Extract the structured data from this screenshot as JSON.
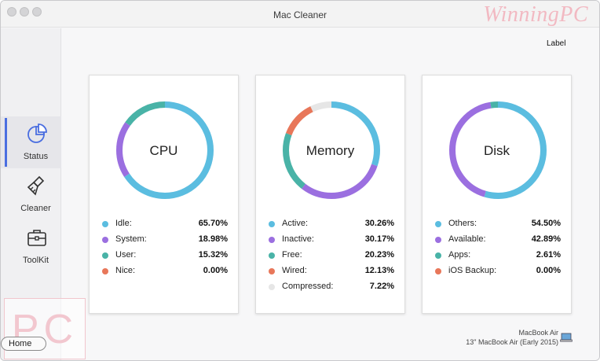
{
  "window": {
    "title": "Mac Cleaner",
    "watermark": "WinningPC"
  },
  "sidebar": {
    "items": [
      {
        "label": "Status",
        "icon": "pie-chart-icon",
        "active": true
      },
      {
        "label": "Cleaner",
        "icon": "brush-icon",
        "active": false
      },
      {
        "label": "ToolKit",
        "icon": "toolbox-icon",
        "active": false
      }
    ]
  },
  "header": {
    "label": "Label"
  },
  "colors": {
    "blue": "#5bbde0",
    "purple": "#9b6fe0",
    "teal": "#49b3a7",
    "orange": "#e8775a",
    "gray": "#e6e6e6",
    "accent": "#4a6ee0"
  },
  "cards": [
    {
      "title": "CPU",
      "legend": [
        {
          "label": "Idle:",
          "value": "65.70%",
          "color": "#5bbde0",
          "pct": 65.7
        },
        {
          "label": "System:",
          "value": "18.98%",
          "color": "#9b6fe0",
          "pct": 18.98
        },
        {
          "label": "User:",
          "value": "15.32%",
          "color": "#49b3a7",
          "pct": 15.32
        },
        {
          "label": "Nice:",
          "value": "0.00%",
          "color": "#e8775a",
          "pct": 0.0
        }
      ]
    },
    {
      "title": "Memory",
      "legend": [
        {
          "label": "Active:",
          "value": "30.26%",
          "color": "#5bbde0",
          "pct": 30.26
        },
        {
          "label": "Inactive:",
          "value": "30.17%",
          "color": "#9b6fe0",
          "pct": 30.17
        },
        {
          "label": "Free:",
          "value": "20.23%",
          "color": "#49b3a7",
          "pct": 20.23
        },
        {
          "label": "Wired:",
          "value": "12.13%",
          "color": "#e8775a",
          "pct": 12.13
        },
        {
          "label": "Compressed:",
          "value": "7.22%",
          "color": "#e6e6e6",
          "pct": 7.22
        }
      ]
    },
    {
      "title": "Disk",
      "legend": [
        {
          "label": "Others:",
          "value": "54.50%",
          "color": "#5bbde0",
          "pct": 54.5
        },
        {
          "label": "Available:",
          "value": "42.89%",
          "color": "#9b6fe0",
          "pct": 42.89
        },
        {
          "label": "Apps:",
          "value": "2.61%",
          "color": "#49b3a7",
          "pct": 2.61
        },
        {
          "label": "iOS Backup:",
          "value": "0.00%",
          "color": "#e8775a",
          "pct": 0.0
        }
      ]
    }
  ],
  "device": {
    "name": "MacBook Air",
    "model": "13\" MacBook Air (Early 2015)",
    "icon": "laptop-icon"
  },
  "footer": {
    "home": "Home",
    "logo": "PC"
  }
}
